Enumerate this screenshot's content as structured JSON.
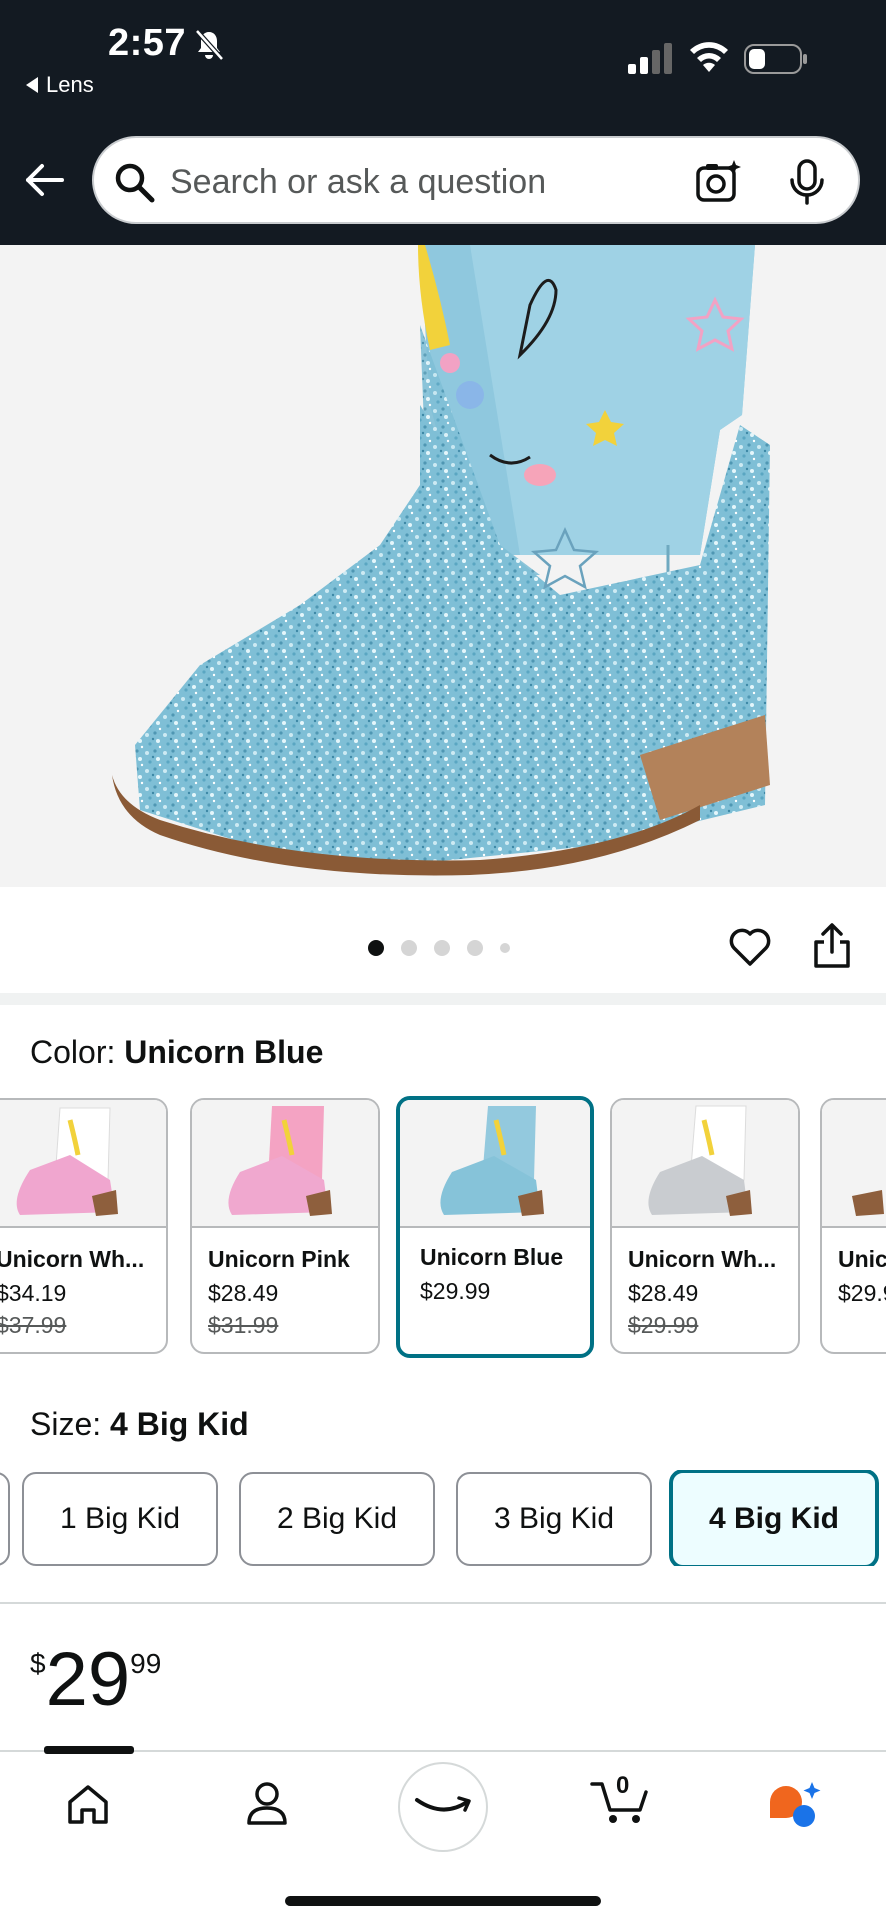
{
  "status_bar": {
    "time": "2:57",
    "back_app": "Lens"
  },
  "search": {
    "placeholder": "Search or ask a question"
  },
  "image_pager": {
    "count": 5,
    "active_index": 0
  },
  "color": {
    "label": "Color:",
    "selected": "Unicorn Blue",
    "options": [
      {
        "name": "Unicorn Wh...",
        "price": "$34.19",
        "was": "$37.99"
      },
      {
        "name": "Unicorn Pink",
        "price": "$28.49",
        "was": "$31.99"
      },
      {
        "name": "Unicorn Blue",
        "price": "$29.99",
        "was": ""
      },
      {
        "name": "Unicorn Wh...",
        "price": "$28.49",
        "was": "$29.99"
      },
      {
        "name": "Unic",
        "price": "$29.9",
        "was": ""
      }
    ]
  },
  "size": {
    "label": "Size:",
    "selected": "4 Big Kid",
    "options": [
      "1 Big Kid",
      "2 Big Kid",
      "3 Big Kid",
      "4 Big Kid"
    ]
  },
  "price": {
    "currency": "$",
    "whole": "29",
    "fraction": "99"
  },
  "nav": {
    "cart_count": "0"
  },
  "colors": {
    "header_bg": "#131a22",
    "accent_teal": "#007185",
    "selected_size_bg": "#edfdff"
  }
}
